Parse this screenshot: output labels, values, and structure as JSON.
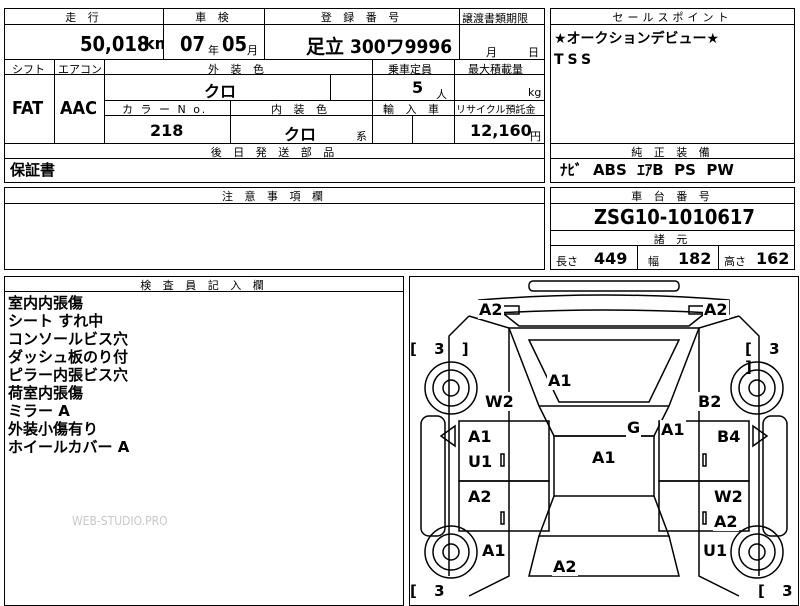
{
  "header": {
    "odometer_label": "走 行",
    "odometer_value": "50,018",
    "odometer_unit": "km",
    "inspection_label": "車 検",
    "inspection_year": "07",
    "inspection_year_unit": "年",
    "inspection_month": "05",
    "inspection_month_unit": "月",
    "registration_label": "登 録 番 号",
    "registration_value": "足立 300ワ9996",
    "transfer_label": "譲渡書類期限",
    "transfer_month_unit": "月",
    "transfer_day_unit": "日",
    "selling_points_label": "セールスポイント",
    "selling_points": [
      "★オークションデビュー★",
      "TSS"
    ]
  },
  "row2": {
    "shift_label": "シフト",
    "shift_value": "FAT",
    "aircon_label": "エアコン",
    "aircon_value": "AAC",
    "exterior_label": "外 装 色",
    "exterior_value": "クロ",
    "capacity_label": "乗車定員",
    "capacity_value": "5",
    "capacity_unit": "人",
    "load_label": "最大積載量",
    "load_unit": "kg",
    "color_no_label": "カ ラ ー N o.",
    "color_no_value": "218",
    "interior_label": "内 装 色",
    "interior_value": "クロ",
    "interior_suffix": "系",
    "import_label": "輸 入 車",
    "recycle_label": "リサイクル預託金",
    "recycle_value": "12,160",
    "recycle_unit": "円"
  },
  "parts": {
    "label": "後 日 発 送 部 品",
    "value": "保証書",
    "equipment_label": "純 正 装 備",
    "equipment_value": "ﾅﾋﾞ  ABS  ｴｱB  PS  PW"
  },
  "caution": {
    "label": "注 意 事 項 欄",
    "chassis_label": "車 台 番 号",
    "chassis_value": "ZSG10-1010617",
    "dims_label": "諸 元",
    "length_label": "長さ",
    "length_value": "449",
    "width_label": "幅",
    "width_value": "182",
    "height_label": "高さ",
    "height_value": "162"
  },
  "inspector": {
    "label": "検 査 員 記 入 欄",
    "notes": [
      "室内内張傷",
      "シート すれ中",
      "コンソールビス穴",
      "ダッシュ板のり付",
      "ピラー内張ビス穴",
      "荷室内張傷",
      "ミラー A",
      "外装小傷有り",
      "ホイールカバー A"
    ],
    "watermark": "WEB-STUDIO.PRO"
  },
  "diagram": {
    "bracket_tl": "[ 3 ]",
    "bracket_tr": "[ 3 ]",
    "bracket_bl": "[ 3",
    "bracket_br": "[ 3",
    "marks": {
      "front_left_corner": "A2",
      "front_right_corner": "A2",
      "hood": "A1",
      "left_front_fender": "W2",
      "right_front_fender": "B2",
      "left_front_door_a": "A1",
      "left_front_door_u": "U1",
      "right_front_door_b": "B4",
      "roof_g": "G",
      "roof_a": "A1",
      "windshield_a": "A1",
      "left_rear_door": "A2",
      "right_rear_door_w": "W2",
      "right_rear_door_a": "A2",
      "left_rear_fender": "A1",
      "right_rear_fender": "U1",
      "rear": "A2"
    }
  }
}
